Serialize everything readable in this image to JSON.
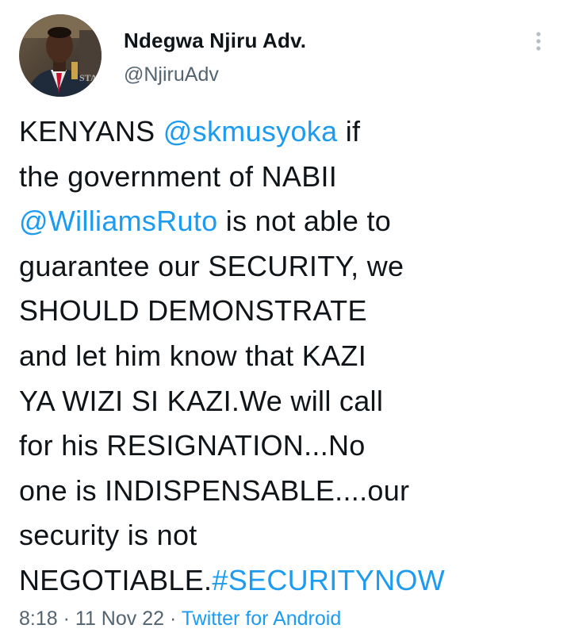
{
  "author": {
    "display_name": "Ndegwa Njiru Adv.",
    "handle": "@NjiruAdv",
    "avatar_watermark": "STAR"
  },
  "tweet": {
    "lines": [
      [
        {
          "text": "KENYANS ",
          "link": false
        },
        {
          "text": "@skmusyoka",
          "link": true
        },
        {
          "text": " if",
          "link": false
        }
      ],
      [
        {
          "text": "the government of NABII",
          "link": false
        }
      ],
      [
        {
          "text": "@WilliamsRuto",
          "link": true
        },
        {
          "text": " is not able to",
          "link": false
        }
      ],
      [
        {
          "text": "guarantee our SECURITY, we",
          "link": false
        }
      ],
      [
        {
          "text": "SHOULD DEMONSTRATE",
          "link": false
        }
      ],
      [
        {
          "text": "and let him know that KAZI",
          "link": false
        }
      ],
      [
        {
          "text": "YA WIZI SI KAZI.We will call",
          "link": false
        }
      ],
      [
        {
          "text": "for his RESIGNATION...No",
          "link": false
        }
      ],
      [
        {
          "text": "one is INDISPENSABLE....our",
          "link": false
        }
      ],
      [
        {
          "text": "security is not",
          "link": false
        }
      ],
      [
        {
          "text": "NEGOTIABLE.",
          "link": false
        },
        {
          "text": "#SECURITYNOW",
          "link": true
        }
      ]
    ]
  },
  "meta": {
    "time": "8:18",
    "separator": " · ",
    "date": "11 Nov 22",
    "source": "Twitter for Android"
  },
  "colors": {
    "link": "#1d9bf0",
    "secondary_text": "#536471",
    "primary_text": "#0f1419"
  },
  "icons": {
    "more": "vertical-ellipsis"
  }
}
